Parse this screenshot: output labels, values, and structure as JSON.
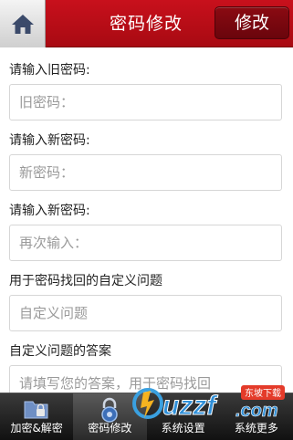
{
  "header": {
    "home_icon": "home-icon",
    "title": "密码修改",
    "modify_label": "修改"
  },
  "form": {
    "fields": [
      {
        "label": "请输入旧密码:",
        "placeholder": "旧密码："
      },
      {
        "label": "请输入新密码:",
        "placeholder": "新密码："
      },
      {
        "label": "请输入新密码:",
        "placeholder": "再次输入："
      },
      {
        "label": "用于密码找回的自定义问题",
        "placeholder": "自定义问题"
      },
      {
        "label": "自定义问题的答案",
        "placeholder": "请填写您的答案，用于密码找回"
      }
    ]
  },
  "tabbar": {
    "tabs": [
      {
        "label": "加密&解密",
        "icon": "folder-lock-icon"
      },
      {
        "label": "密码修改",
        "icon": "padlock-icon",
        "active": true
      },
      {
        "label": "系统设置",
        "icon": "settings-icon"
      },
      {
        "label": "系统更多",
        "icon": "more-icon"
      }
    ]
  },
  "watermark": {
    "brand": "uzzf",
    "domain": ".com",
    "tag": "东坡下载"
  },
  "colors": {
    "header_red": "#b80d16",
    "button_dark_red": "#7a070e",
    "tabbar_dark": "#1c1c1c"
  }
}
